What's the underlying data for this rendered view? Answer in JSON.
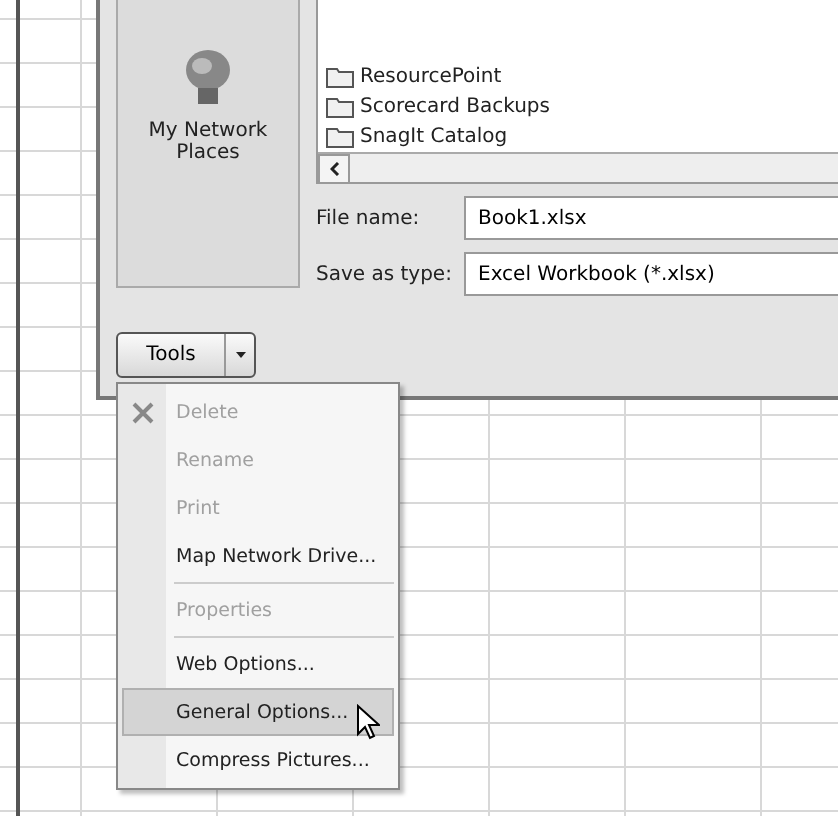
{
  "places_bar": {
    "items": [
      {
        "label": "My Network\nPlaces"
      }
    ]
  },
  "file_list": {
    "folders": [
      {
        "name": "ResourcePoint"
      },
      {
        "name": "Scorecard Backups"
      },
      {
        "name": "SnagIt Catalog"
      }
    ]
  },
  "fields": [
    {
      "label": "File name:",
      "value": "Book1.xlsx"
    },
    {
      "label": "Save as type:",
      "value": "Excel Workbook (*.xlsx)"
    }
  ],
  "tools_button": {
    "label": "Tools"
  },
  "menu": {
    "groups": [
      [
        {
          "label": "Delete",
          "disabled": true,
          "selected": false
        },
        {
          "label": "Rename",
          "disabled": true,
          "selected": false
        },
        {
          "label": "Print",
          "disabled": true,
          "selected": false
        },
        {
          "label": "Map Network Drive...",
          "disabled": false,
          "selected": false
        }
      ],
      [
        {
          "label": "Properties",
          "disabled": true,
          "selected": false
        }
      ],
      [
        {
          "label": "Web Options...",
          "disabled": false,
          "selected": false
        },
        {
          "label": "General Options...",
          "disabled": false,
          "selected": true
        },
        {
          "label": "Compress Pictures...",
          "disabled": false,
          "selected": false
        }
      ]
    ]
  }
}
